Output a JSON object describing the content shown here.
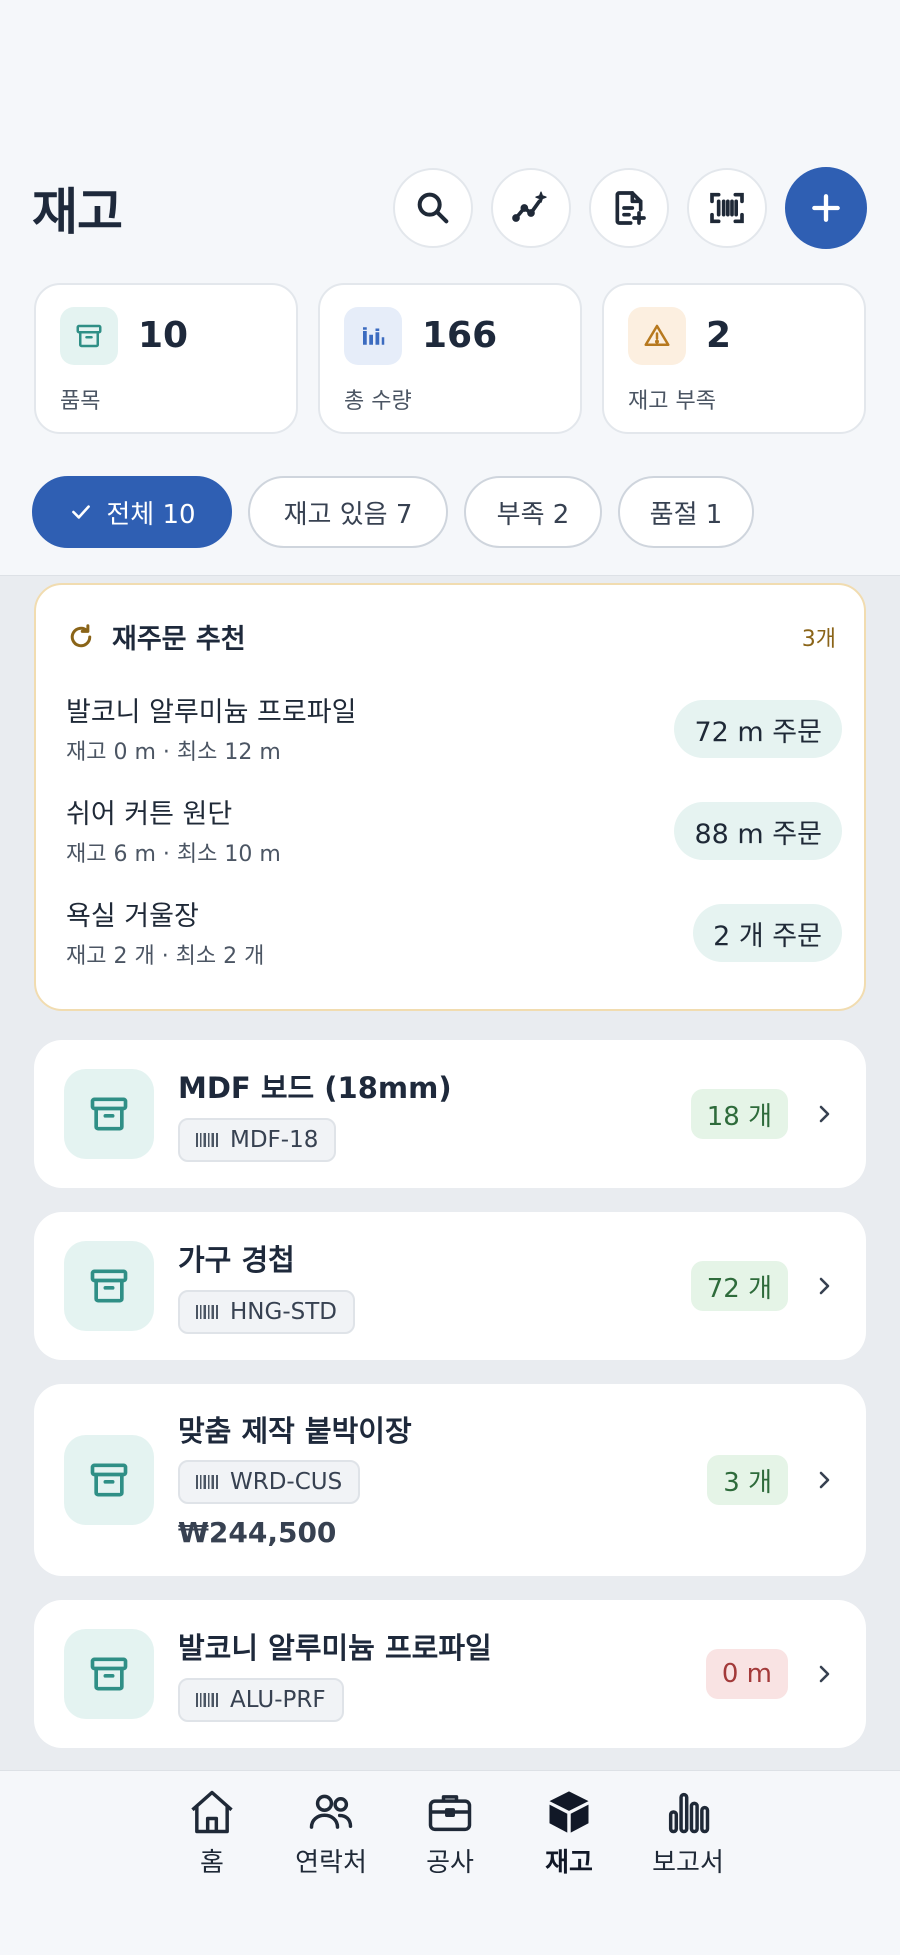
{
  "header": {
    "title": "재고"
  },
  "icons": {
    "search": "search-icon",
    "insights": "sparkle-chart-icon",
    "report": "document-add-icon",
    "scan": "barcode-scan-icon",
    "add": "plus-icon"
  },
  "stats": [
    {
      "value": "10",
      "label": "품목",
      "icon": "box-icon"
    },
    {
      "value": "166",
      "label": "총 수량",
      "icon": "bar-chart-icon"
    },
    {
      "value": "2",
      "label": "재고 부족",
      "icon": "warning-icon"
    }
  ],
  "filters": [
    {
      "label": "전체 10",
      "active": true
    },
    {
      "label": "재고 있음 7",
      "active": false
    },
    {
      "label": "부족 2",
      "active": false
    },
    {
      "label": "품절 1",
      "active": false
    }
  ],
  "reorder": {
    "title": "재주문 추천",
    "count": "3개",
    "items": [
      {
        "name": "발코니 알루미늄 프로파일",
        "stock": "재고 0 m · 최소 12 m",
        "action": "72 m 주문"
      },
      {
        "name": "쉬어 커튼 원단",
        "stock": "재고 6 m · 최소 10 m",
        "action": "88 m 주문"
      },
      {
        "name": "욕실 거울장",
        "stock": "재고 2 개 · 최소 2 개",
        "action": "2 개 주문"
      }
    ]
  },
  "items": [
    {
      "name": "MDF 보드 (18mm)",
      "sku": "MDF-18",
      "qty": "18 개",
      "price": ""
    },
    {
      "name": "가구 경첩",
      "sku": "HNG-STD",
      "qty": "72 개",
      "price": ""
    },
    {
      "name": "맞춤 제작 붙박이장",
      "sku": "WRD-CUS",
      "qty": "3 개",
      "price": "₩244,500"
    },
    {
      "name": "발코니 알루미늄 프로파일",
      "sku": "ALU-PRF",
      "qty": "0 m",
      "price": ""
    }
  ],
  "nav": [
    {
      "label": "홈",
      "icon": "home-icon"
    },
    {
      "label": "연락처",
      "icon": "contacts-icon"
    },
    {
      "label": "공사",
      "icon": "briefcase-icon"
    },
    {
      "label": "재고",
      "icon": "cube-icon",
      "active": true
    },
    {
      "label": "보고서",
      "icon": "bar-chart-icon"
    }
  ],
  "colors": {
    "primary": "#2f5fb3",
    "teal_accent": "#2f8f86",
    "warning": "#b7791f",
    "ok_qty": "#2e6b3b",
    "zero_qty": "#a33a3a"
  }
}
